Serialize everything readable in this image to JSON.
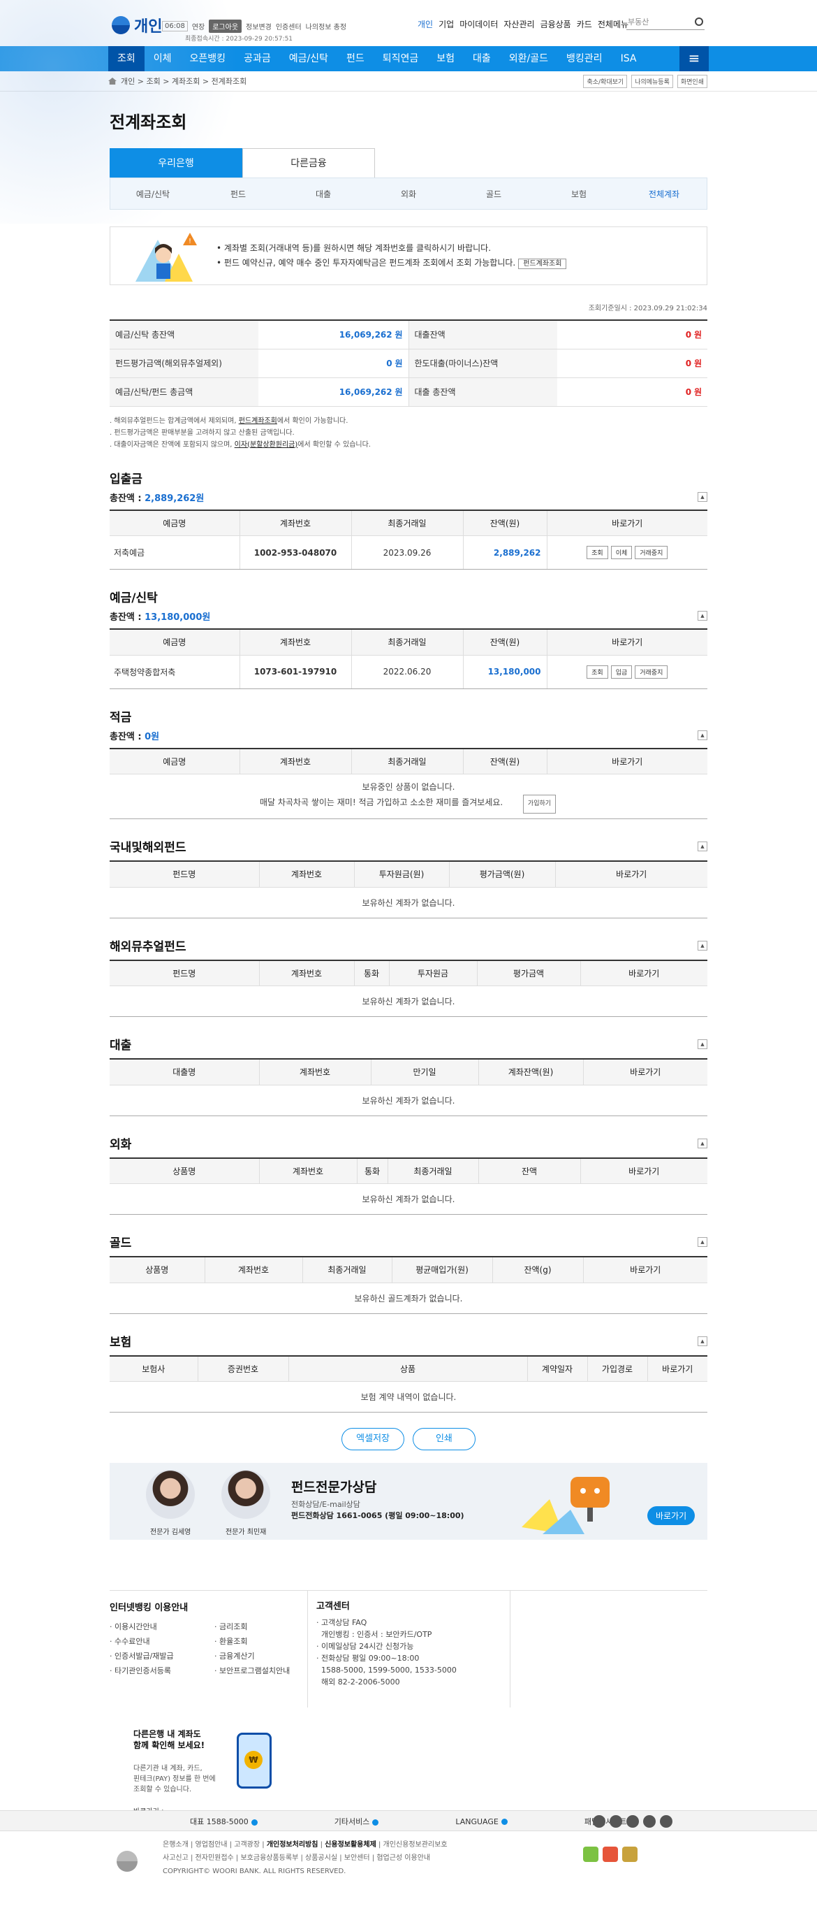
{
  "header": {
    "brand": "개인",
    "timer": "06:08",
    "extend": "연장",
    "logout": "로그아웃",
    "links": [
      "정보변경",
      "인증센터",
      "나의정보 총정"
    ],
    "last_login": "최종접속시간 : 2023-09-29 20:57:51",
    "gnav": [
      "개인",
      "기업",
      "마이데이터",
      "자산관리",
      "금융상품",
      "카드",
      "전체메뉴"
    ],
    "search_placeholder": "부동산"
  },
  "main_nav": [
    "조회",
    "이체",
    "오픈뱅킹",
    "공과금",
    "예금/신탁",
    "펀드",
    "퇴직연금",
    "보험",
    "대출",
    "외환/골드",
    "뱅킹관리",
    "ISA"
  ],
  "breadcrumb": {
    "items": [
      "개인",
      "조회",
      "계좌조회",
      "전계좌조회"
    ],
    "buttons": [
      "축소/확대보기",
      "나의메뉴등록",
      "화면인쇄"
    ]
  },
  "page_title": "전계좌조회",
  "tabs": [
    "우리은행",
    "다른금융"
  ],
  "subtabs": [
    "예금/신탁",
    "펀드",
    "대출",
    "외화",
    "골드",
    "보험",
    "전체계좌"
  ],
  "notice": {
    "line1": "계좌별 조회(거래내역 등)를 원하시면 해당 계좌번호를 클릭하시기 바랍니다.",
    "line2": "펀드 예약신규, 예약 매수 중인 투자자예탁금은 펀드계좌 조회에서 조회 가능합니다.",
    "button": "펀드계좌조회"
  },
  "timestamp": "조회기준일시 : 2023.09.29 21:02:34",
  "summary": [
    {
      "label": "예금/신탁 총잔액",
      "value": "16,069,262",
      "unit": "원",
      "label2": "대출잔액",
      "value2": "0",
      "unit2": "원"
    },
    {
      "label": "펀드평가금액(해외뮤추얼제외)",
      "value": "0",
      "unit": "원",
      "label2": "한도대출(마이너스)잔액",
      "value2": "0",
      "unit2": "원"
    },
    {
      "label": "예금/신탁/펀드 총금액",
      "value": "16,069,262",
      "unit": "원",
      "label2": "대출 총잔액",
      "value2": "0",
      "unit2": "원"
    }
  ],
  "notes": {
    "n1a": "해외뮤추얼펀드는 합계금액에서 제외되며, ",
    "n1b": "펀드계좌조회",
    "n1c": "에서 확인이 가능합니다.",
    "n2": "펀드평가금액은 판매부분을 고려하지 않고 산출된 금액입니다.",
    "n3a": "대출이자금액은 잔액에 포함되지 않으며, ",
    "n3b": "이자(분할상환원리금)",
    "n3c": "에서 확인할 수 있습니다."
  },
  "deposit": {
    "title": "입출금",
    "total_label": "총잔액 : ",
    "total": "2,889,262원",
    "headers": [
      "예금명",
      "계좌번호",
      "최종거래일",
      "잔액(원)",
      "바로가기"
    ],
    "row": {
      "name": "저축예금",
      "account": "1002-953-048070",
      "date": "2023.09.26",
      "balance": "2,889,262",
      "actions": [
        "조회",
        "이체",
        "거래중지"
      ]
    }
  },
  "savings": {
    "title": "예금/신탁",
    "total_label": "총잔액 : ",
    "total": "13,180,000원",
    "headers": [
      "예금명",
      "계좌번호",
      "최종거래일",
      "잔액(원)",
      "바로가기"
    ],
    "row": {
      "name": "주택청약종합저축",
      "account": "1073-601-197910",
      "date": "2022.06.20",
      "balance": "13,180,000",
      "actions": [
        "조회",
        "입금",
        "거래중지"
      ]
    }
  },
  "installment": {
    "title": "적금",
    "total_label": "총잔액 : ",
    "total": "0원",
    "headers": [
      "예금명",
      "계좌번호",
      "최종거래일",
      "잔액(원)",
      "바로가기"
    ],
    "empty1": "보유중인 상품이 없습니다.",
    "empty2": "매달 차곡차곡 쌓이는 재미! 적금 가입하고 소소한 재미를 즐겨보세요.",
    "button": "가입하기"
  },
  "fund": {
    "title": "국내및해외펀드",
    "headers": [
      "펀드명",
      "계좌번호",
      "투자원금(원)",
      "평가금액(원)",
      "바로가기"
    ],
    "empty": "보유하신 계좌가 없습니다."
  },
  "mutual": {
    "title": "해외뮤추얼펀드",
    "headers": [
      "펀드명",
      "계좌번호",
      "통화",
      "투자원금",
      "평가금액",
      "바로가기"
    ],
    "empty": "보유하신 계좌가 없습니다."
  },
  "loan": {
    "title": "대출",
    "headers": [
      "대출명",
      "계좌번호",
      "만기일",
      "계좌잔액(원)",
      "바로가기"
    ],
    "empty": "보유하신 계좌가 없습니다."
  },
  "forex": {
    "title": "외화",
    "headers": [
      "상품명",
      "계좌번호",
      "통화",
      "최종거래일",
      "잔액",
      "바로가기"
    ],
    "empty": "보유하신 계좌가 없습니다."
  },
  "gold": {
    "title": "골드",
    "headers": [
      "상품명",
      "계좌번호",
      "최종거래일",
      "평균매입가(원)",
      "잔액(g)",
      "바로가기"
    ],
    "empty": "보유하신 골드계좌가 없습니다."
  },
  "insurance": {
    "title": "보험",
    "headers": [
      "보험사",
      "증권번호",
      "상품",
      "계약일자",
      "가입경로",
      "바로가기"
    ],
    "empty": "보험 계약 내역이 없습니다."
  },
  "actions": [
    "엑셀저장",
    "인쇄"
  ],
  "banner": {
    "expert1": "전문가 김세영",
    "expert2": "전문가 최민재",
    "title": "펀드전문가상담",
    "sub1": "전화상담/E-mail상담",
    "sub2": "펀드전화상담 1661-0065 (평일 09:00~18:00)",
    "button": "바로가기"
  },
  "footer_info": {
    "col1_title": "인터넷뱅킹 이용안내",
    "col1_items": [
      "이용시간안내",
      "금리조회",
      "수수료안내",
      "환율조회",
      "인증서발급/재발급",
      "금융계산기",
      "타기관인증서등록",
      "보안프로그램설치안내"
    ],
    "col2_title": "고객센터",
    "col2_lines": [
      "고객상담 FAQ",
      "개인뱅킹 : 인증서 : 보안카드/OTP",
      "이메일상담 24시간 신청가능",
      "전화상담 평일 09:00~18:00",
      "1588-5000, 1599-5000, 1533-5000",
      "해외 82-2-2006-5000"
    ],
    "promo_title1": "다른은행 내 계좌도",
    "promo_title2": "함께 확인해 보세요!",
    "promo_desc1": "다른기관 내 계좌, 카드,",
    "promo_desc2": "핀테크(PAY) 정보를 한 번에",
    "promo_desc3": "조회할 수 있습니다.",
    "promo_more": "바로가기 >"
  },
  "footer_bar": [
    "대표 1588-5000",
    "기타서비스",
    "LANGUAGE",
    "패밀리사이트"
  ],
  "legal": {
    "line1": [
      "은행소개",
      "영업점안내",
      "고객광장",
      "개인정보처리방침",
      "신용정보활용체제",
      "개인신용정보관리보호"
    ],
    "line2": [
      "사고신고",
      "전자민원접수",
      "보호금융상품등록부",
      "상품공시실",
      "보안센터",
      "협업근성 이용안내"
    ],
    "copyright": "COPYRIGHT© WOORI BANK. ALL RIGHTS RESERVED."
  },
  "colors": {
    "primary": "#0e8ee5",
    "navy": "#0054a8",
    "accent_blue": "#1a6fd0",
    "red": "#e02020"
  }
}
